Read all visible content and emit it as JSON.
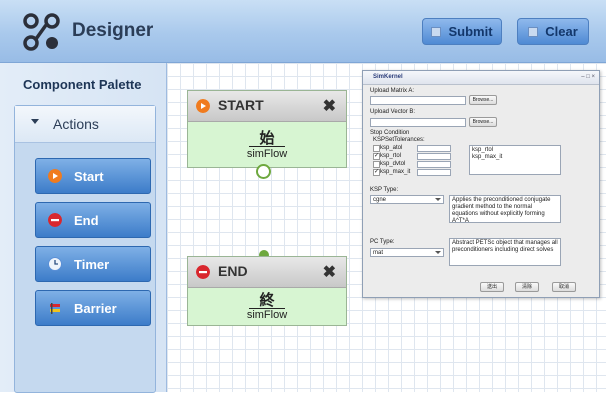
{
  "header": {
    "title": "Designer",
    "submit_label": "Submit",
    "clear_label": "Clear"
  },
  "palette": {
    "title": "Component Palette",
    "group_label": "Actions",
    "items": [
      {
        "label": "Start",
        "icon": "play-icon",
        "color": "#f07b1e"
      },
      {
        "label": "End",
        "icon": "stop-icon",
        "color": "#d9272e"
      },
      {
        "label": "Timer",
        "icon": "clock-icon",
        "color": "#5a8fd6"
      },
      {
        "label": "Barrier",
        "icon": "barrier-icon",
        "color": "#d9272e"
      }
    ]
  },
  "nodes": {
    "start": {
      "title": "START",
      "char": "始",
      "sub": "simFlow",
      "icon": "play-icon"
    },
    "end": {
      "title": "END",
      "char": "終",
      "sub": "simFlow",
      "icon": "stop-icon"
    }
  },
  "dialog": {
    "title": "SimKernel",
    "upload_matrix_label": "Upload Matrix A:",
    "upload_vector_label": "Upload Vector B:",
    "browse_label": "Browse...",
    "stop_condition_label": "Stop Condition",
    "tolerances_label": "KSPSetTolerances:",
    "tolerances": [
      {
        "label": "ksp_atol",
        "checked": false
      },
      {
        "label": "ksp_rtol",
        "checked": true
      },
      {
        "label": "ksp_dvtol",
        "checked": false
      },
      {
        "label": "ksp_max_it",
        "checked": true
      }
    ],
    "selected_tolerances": [
      "ksp_rtol",
      "ksp_max_it"
    ],
    "ksp_type_label": "KSP Type:",
    "ksp_type_value": "cgne",
    "ksp_desc": "Applies the preconditioned conjugate gradient method to the normal equations without explicitly forming A^T*A",
    "pc_type_label": "PC Type:",
    "pc_type_value": "mat",
    "pc_desc": "Abstract PETSc object that manages all preconditioners including direct solves",
    "buttons": [
      "送出",
      "清除",
      "取消"
    ]
  },
  "colors": {
    "accent": "#3c7cc9",
    "node_body": "#d7f5d2",
    "port": "#6ea83e"
  }
}
